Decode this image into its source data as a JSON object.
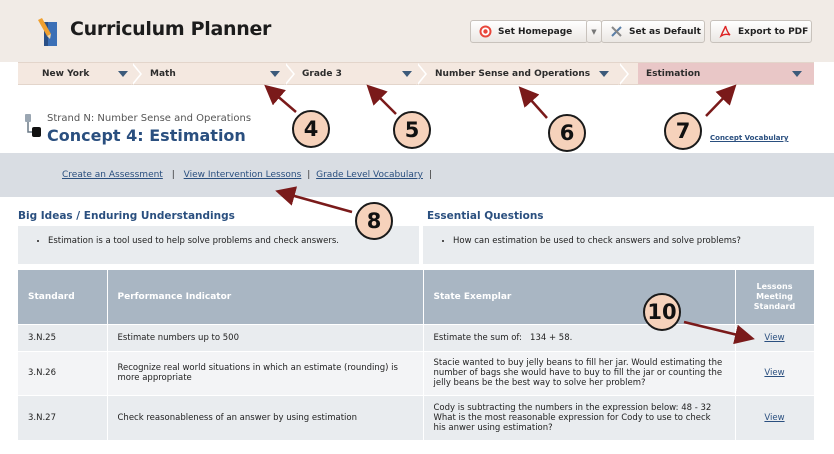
{
  "app": {
    "title": "Curriculum Planner"
  },
  "toolbar": {
    "set_homepage": "Set Homepage",
    "set_default": "Set as Default",
    "export_pdf": "Export to PDF"
  },
  "breadcrumb": {
    "state": "New York",
    "subject": "Math",
    "grade": "Grade 3",
    "strand": "Number Sense and Operations",
    "concept": "Estimation"
  },
  "concept": {
    "strand_label": "Strand N: Number Sense and Operations",
    "title": "Concept 4: Estimation",
    "vocab_link": "Concept Vocabulary"
  },
  "links": {
    "create_assessment": "Create an Assessment",
    "sep1": "|",
    "intervention": "View Intervention Lessons",
    "sep2": "|",
    "grade_vocab": "Grade Level Vocabulary",
    "sep3": "|"
  },
  "big_ideas": {
    "title": "Big Ideas / Enduring Understandings",
    "item": "Estimation is a tool used to help solve problems and check answers."
  },
  "essential_questions": {
    "title": "Essential Questions",
    "item": "How can estimation be used to check answers and solve problems?"
  },
  "table": {
    "headers": {
      "standard": "Standard",
      "indicator": "Performance Indicator",
      "exemplar": "State Exemplar",
      "lessons_1": "Lessons",
      "lessons_2": "Meeting",
      "lessons_3": "Standard"
    },
    "rows": [
      {
        "standard": "3.N.25",
        "indicator": "Estimate numbers up to 500",
        "exemplar": "Estimate the sum of:   134 + 58.",
        "view": "View"
      },
      {
        "standard": "3.N.26",
        "indicator": "Recognize real world situations in which an estimate (rounding) is more appropriate",
        "exemplar": "Stacie wanted to buy jelly beans to fill her jar. Would estimating the number of bags she would have to buy to fill the jar or counting the jelly beans be the best way to solve her problem?",
        "view": "View"
      },
      {
        "standard": "3.N.27",
        "indicator": "Check reasonableness of an answer by using estimation",
        "exemplar": "Cody is subtracting the numbers in the expression below:   48 - 32 What is the most reasonable expression for Cody to use to check his anwer using estimation?",
        "view": "View"
      }
    ]
  },
  "callouts": {
    "c4": "4",
    "c5": "5",
    "c6": "6",
    "c7": "7",
    "c8": "8",
    "c10": "10"
  },
  "colors": {
    "header_bg": "#f1ebe6",
    "accent_blue": "#2a4f7f",
    "table_header": "#a9b6c3",
    "active_crumb": "#e9c7c7",
    "callout_fill": "#f6d2bb"
  },
  "icons": {
    "logo": "pencil-book-icon",
    "home": "target-icon",
    "default": "tools-icon",
    "pdf": "pdf-icon",
    "strand": "hierarchy-icon"
  }
}
